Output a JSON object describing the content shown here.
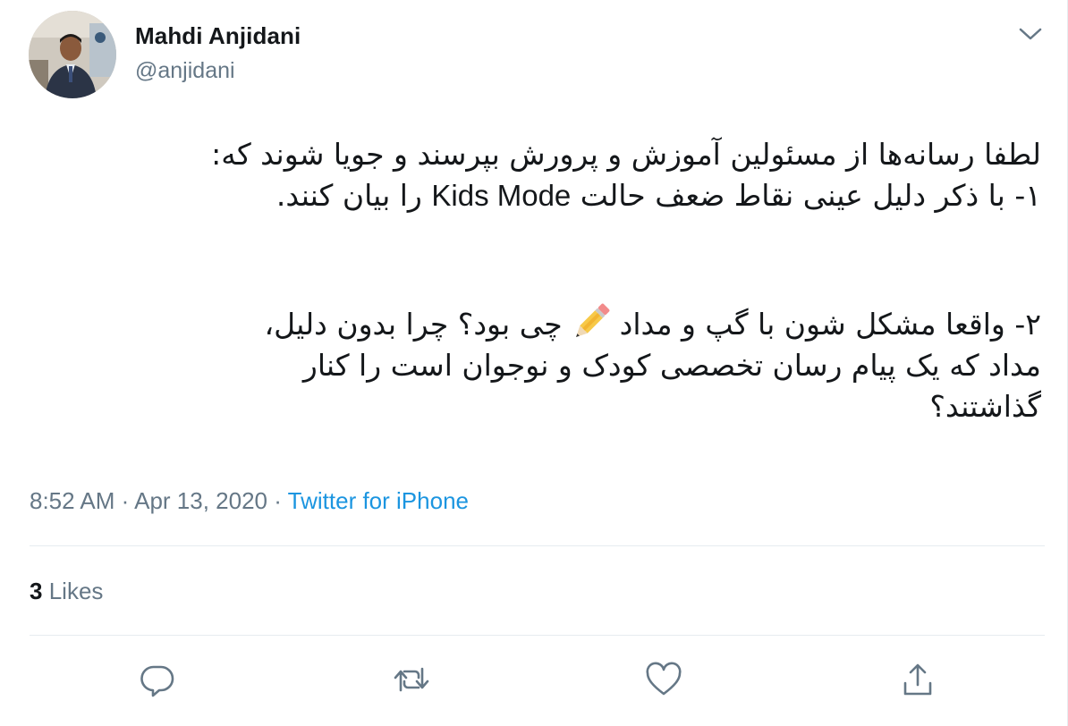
{
  "author": {
    "name": "Mahdi Anjidani",
    "handle": "@anjidani"
  },
  "tweet": {
    "lines": [
      "لطفا رسانه‌ها از مسئولین آموزش و پرورش بپرسند و جویا شوند که:",
      "۱- با ذکر دلیل عینی نقاط ضعف حالت",
      "Kids Mode",
      "را بیان کنند.",
      "۲- واقعا مشکل شون با گپ و مداد",
      "چی بود؟ چرا بدون دلیل،",
      "مداد که یک پیام رسان تخصصی کودک و نوجوان است را کنار",
      "گذاشتند؟"
    ],
    "emoji": "pencil-icon"
  },
  "meta": {
    "time": "8:52 AM",
    "separator": "·",
    "date": "Apr 13, 2020",
    "source": "Twitter for iPhone"
  },
  "stats": {
    "likes_count": "3",
    "likes_label": "Likes"
  },
  "icons": {
    "reply": "reply-icon",
    "retweet": "retweet-icon",
    "like": "like-icon",
    "share": "share-icon",
    "caret": "chevron-down-icon"
  },
  "colors": {
    "text": "#14171a",
    "secondary": "#657786",
    "link": "#1b95e0",
    "divider": "#e6ecf0"
  }
}
